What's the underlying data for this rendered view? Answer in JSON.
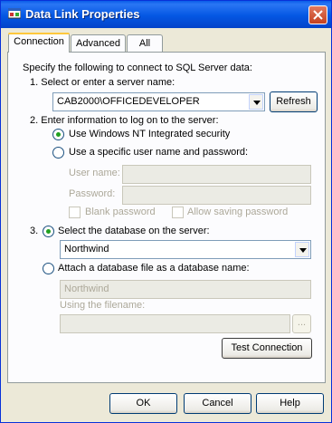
{
  "window": {
    "title": "Data Link Properties"
  },
  "tabs": [
    {
      "label": "Connection",
      "active": true
    },
    {
      "label": "Advanced",
      "active": false
    },
    {
      "label": "All",
      "active": false
    }
  ],
  "intro": "Specify the following to connect to SQL Server data:",
  "step1": {
    "label": "1. Select or enter a server name:",
    "server_value": "CAB2000\\OFFICEDEVELOPER",
    "refresh_label": "Refresh"
  },
  "step2": {
    "label": "2. Enter information to log on to the server:",
    "nt_security_label": "Use Windows NT Integrated security",
    "nt_security_selected": true,
    "specific_user_label": "Use a specific user name and password:",
    "specific_user_selected": false,
    "user_name_label": "User name:",
    "user_name_value": "",
    "password_label": "Password:",
    "password_value": "",
    "blank_password_label": "Blank password",
    "allow_saving_label": "Allow saving password"
  },
  "step3": {
    "number": "3.",
    "select_db_label": "Select the database on the server:",
    "select_db_selected": true,
    "database_value": "Northwind",
    "attach_label": "Attach a database file as a database name:",
    "attach_selected": false,
    "attach_name_value": "Northwind",
    "filename_label": "Using the filename:",
    "filename_value": "",
    "browse_label": "..."
  },
  "test_connection_label": "Test Connection",
  "footer": {
    "ok_label": "OK",
    "cancel_label": "Cancel",
    "help_label": "Help"
  },
  "colors": {
    "titlebar": "#0457e3",
    "dialog": "#ece9d8",
    "radio_dot": "#21a121",
    "tab_highlight": "#ffc83c"
  },
  "icons": {
    "title": "data-link-icon",
    "close": "close-icon",
    "dropdown": "chevron-down-icon"
  }
}
